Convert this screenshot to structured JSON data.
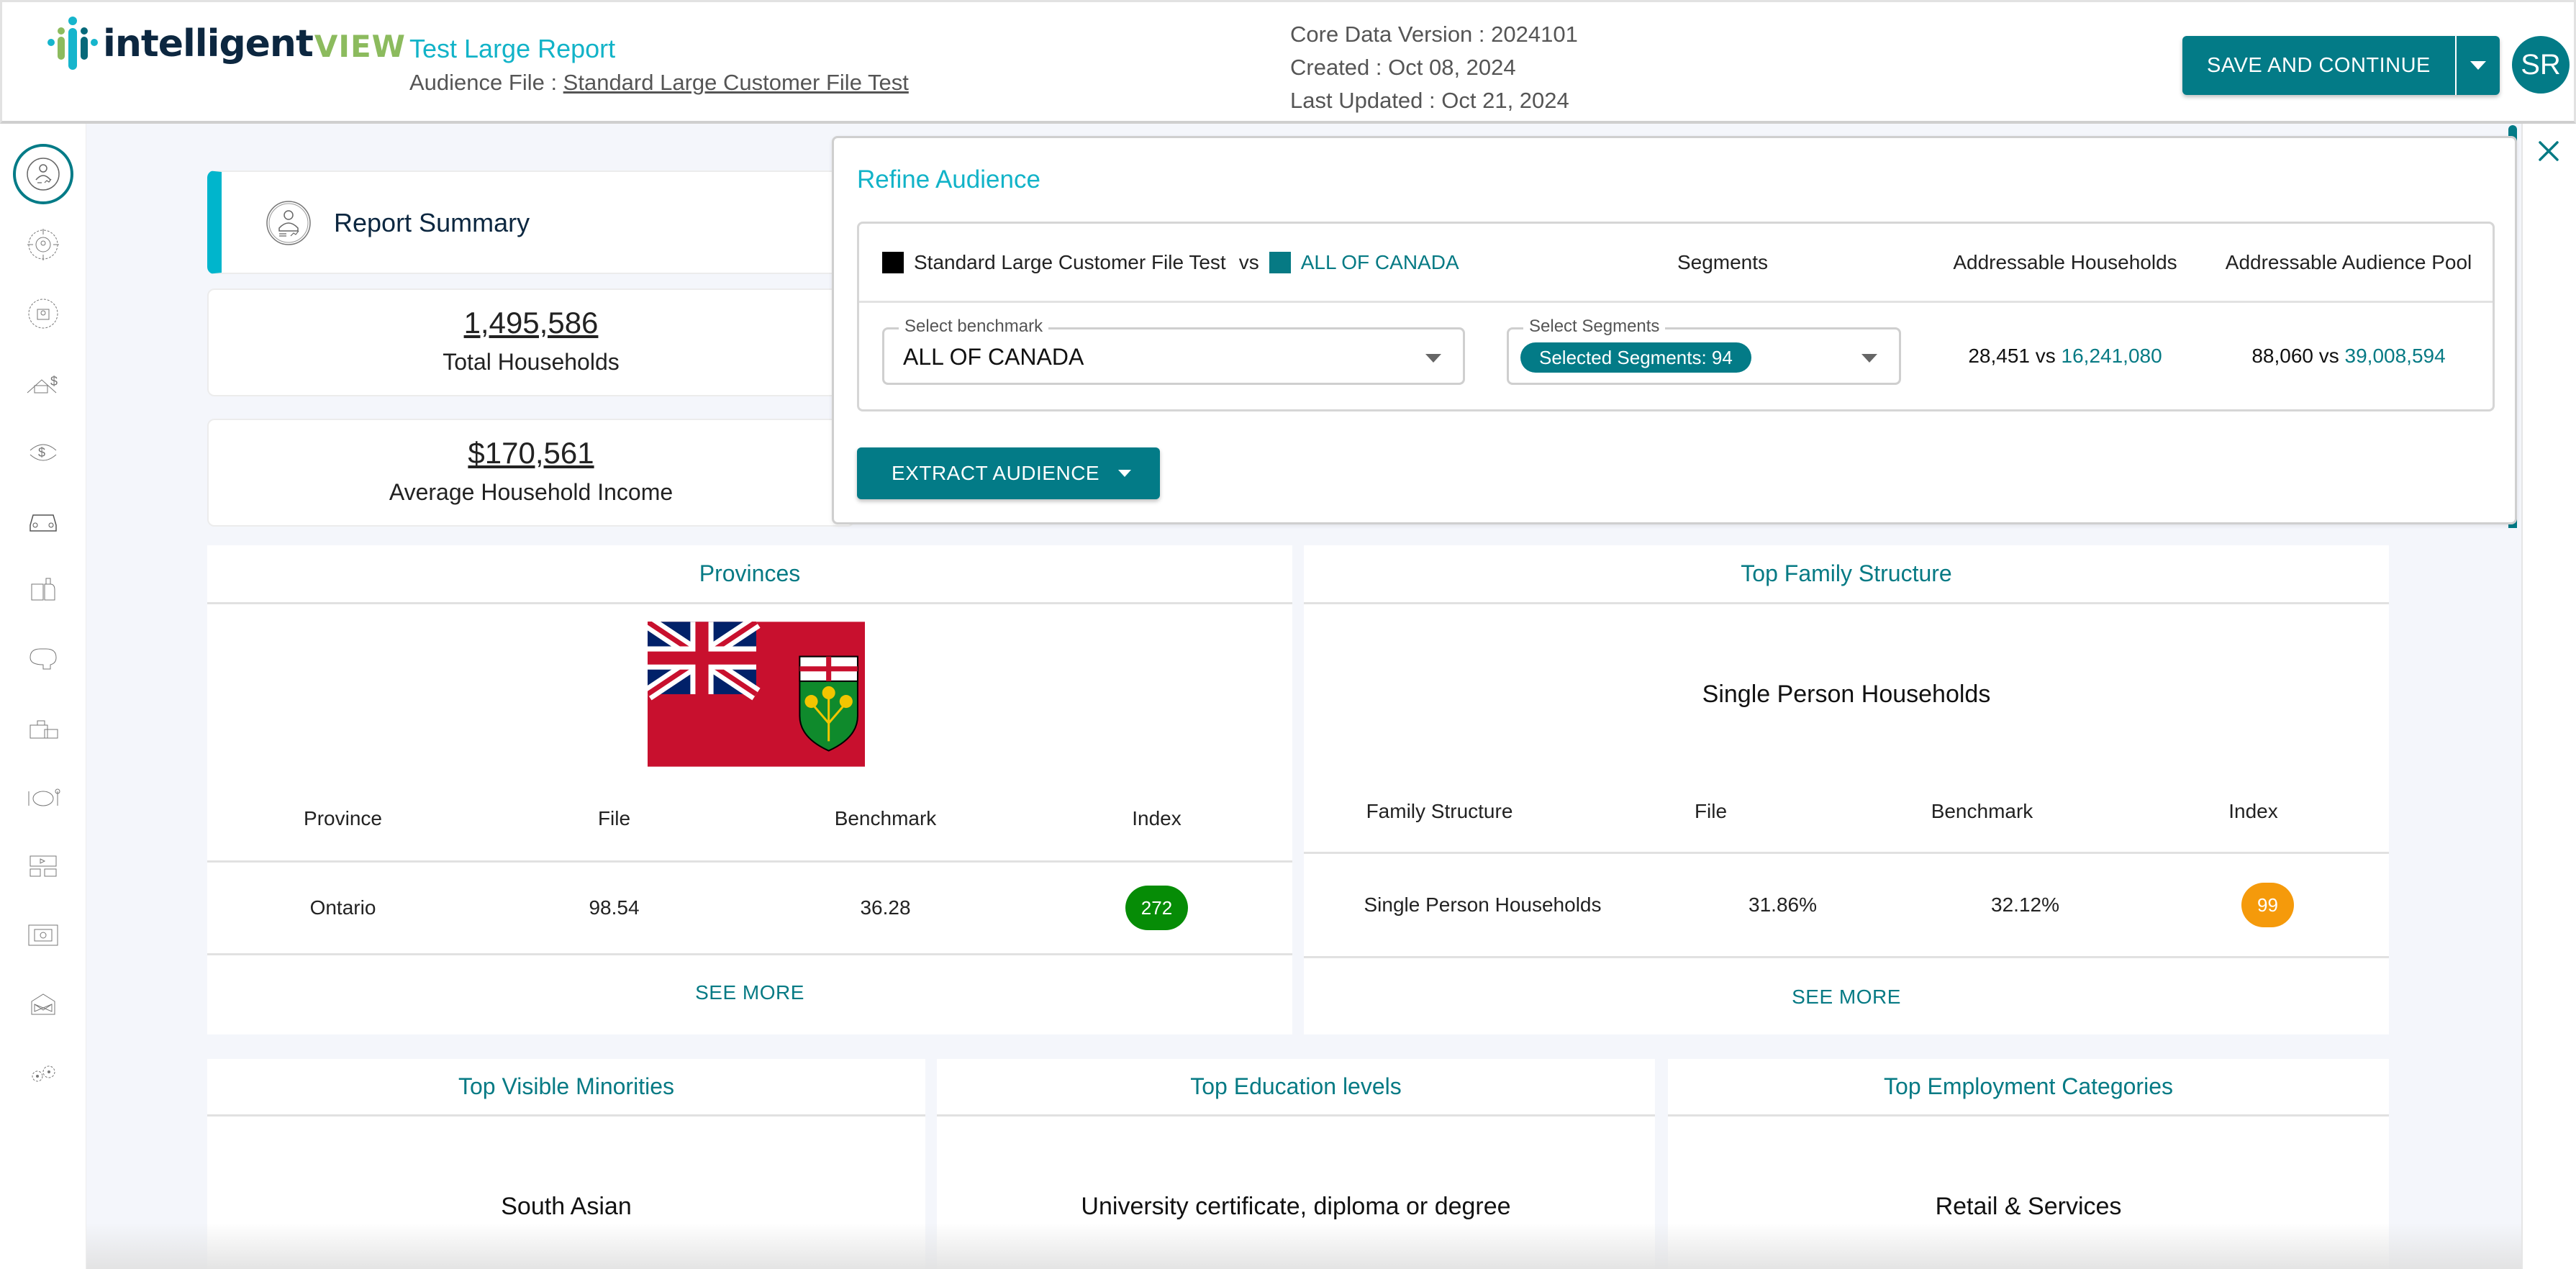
{
  "header": {
    "logo_word": "intelligent",
    "logo_view": "VIEW",
    "report_title": "Test Large Report",
    "audience_label": "Audience File : ",
    "audience_file": "Standard Large Customer File Test",
    "core_data_version": "Core Data Version : 2024101",
    "created": "Created : Oct 08, 2024",
    "last_updated": "Last Updated : Oct 21, 2024",
    "save_label": "SAVE AND CONTINUE",
    "avatar_initials": "SR"
  },
  "sidebar": {
    "items": [
      {
        "icon": "report-summary-icon",
        "active": true
      },
      {
        "icon": "target-audience-icon"
      },
      {
        "icon": "demographics-icon"
      },
      {
        "icon": "housing-finance-icon"
      },
      {
        "icon": "money-exchange-icon"
      },
      {
        "icon": "car-icon"
      },
      {
        "icon": "beverage-icon"
      },
      {
        "icon": "mindset-icon"
      },
      {
        "icon": "shopping-icon"
      },
      {
        "icon": "dining-icon"
      },
      {
        "icon": "media-icon"
      },
      {
        "icon": "video-icon"
      },
      {
        "icon": "mail-icon"
      },
      {
        "icon": "settings-gears-icon"
      }
    ]
  },
  "summary": {
    "title": "Report Summary",
    "total_households_value": "1,495,586",
    "total_households_label": "Total Households",
    "avg_income_value": "$170,561",
    "avg_income_label": "Average Household Income"
  },
  "refine": {
    "title": "Refine Audience",
    "file_name": "Standard Large Customer File Test",
    "vs": "vs",
    "benchmark_name": "ALL OF CANADA",
    "col_segments": "Segments",
    "col_households": "Addressable Households",
    "col_pool": "Addressable Audience Pool",
    "benchmark_label": "Select benchmark",
    "benchmark_value": "ALL OF CANADA",
    "segments_label": "Select Segments",
    "segments_chip": "Selected Segments: 94",
    "households_file": "28,451",
    "households_benchmark": "16,241,080",
    "pool_file": "88,060",
    "pool_benchmark": "39,008,594",
    "extract_label": "EXTRACT AUDIENCE",
    "colors": {
      "file": "#000000",
      "benchmark": "#067a84"
    }
  },
  "provinces": {
    "title": "Provinces",
    "flag": "ontario-flag",
    "columns": [
      "Province",
      "File",
      "Benchmark",
      "Index"
    ],
    "rows": [
      {
        "name": "Ontario",
        "file": "98.54",
        "benchmark": "36.28",
        "index": "272",
        "index_color": "#068c06"
      }
    ],
    "see_more": "SEE MORE"
  },
  "family": {
    "title": "Top Family Structure",
    "top_value": "Single Person Households",
    "columns": [
      "Family Structure",
      "File",
      "Benchmark",
      "Index"
    ],
    "rows": [
      {
        "name": "Single Person Households",
        "file": "31.86%",
        "benchmark": "32.12%",
        "index": "99",
        "index_color": "#f59a0b"
      }
    ],
    "see_more": "SEE MORE"
  },
  "bottom_panels": [
    {
      "title": "Top Visible Minorities",
      "value": "South Asian"
    },
    {
      "title": "Top Education levels",
      "value": "University certificate, diploma or degree"
    },
    {
      "title": "Top Employment Categories",
      "value": "Retail & Services"
    }
  ]
}
